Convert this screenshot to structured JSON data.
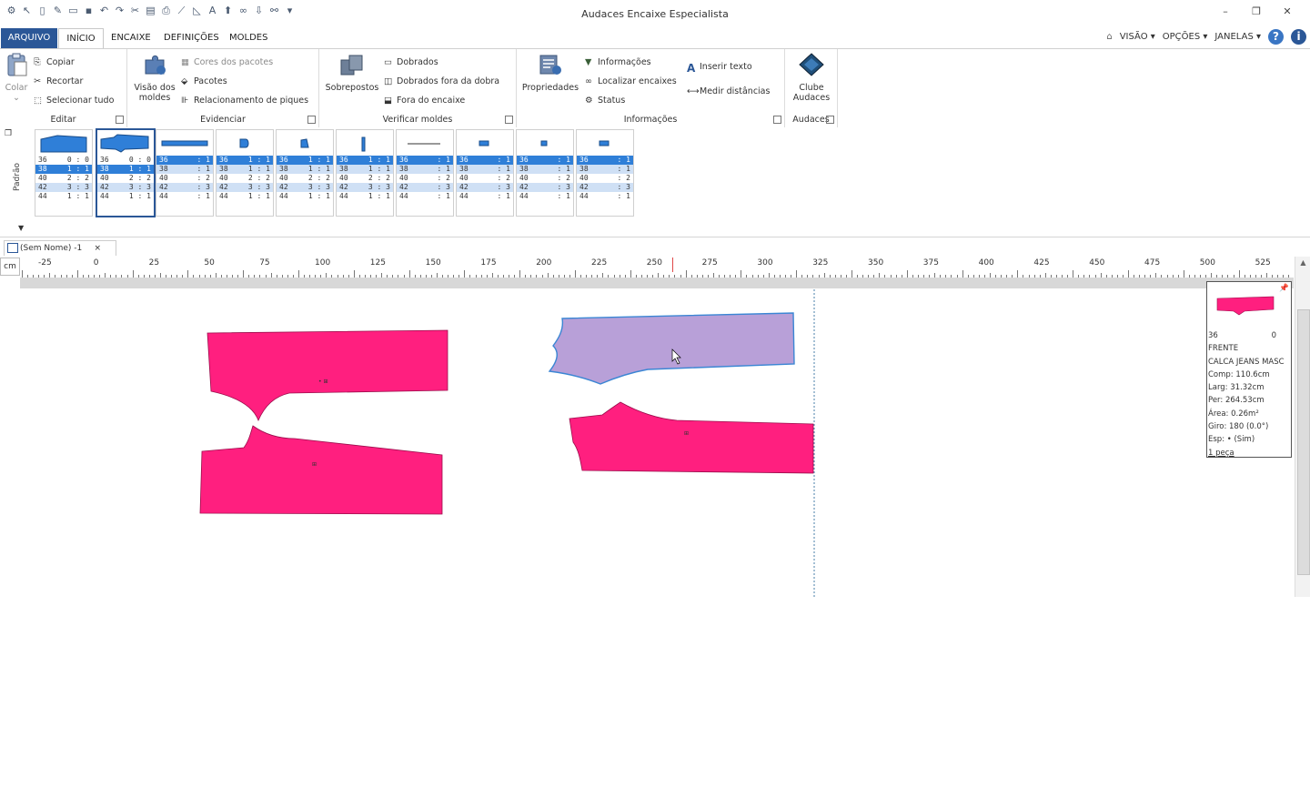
{
  "window": {
    "title": "Audaces Encaixe Especialista",
    "controls": [
      "–",
      "❐",
      "✕"
    ]
  },
  "tabs": {
    "arquivo": "ARQUIVO",
    "inicio": "INÍCIO",
    "encaixe": "ENCAIXE",
    "definicoes": "DEFINIÇÕES",
    "moldes": "MOLDES"
  },
  "right_menu": {
    "visao": "VISÃO ▾",
    "opcoes": "OPÇÕES ▾",
    "janelas": "JANELAS ▾",
    "help": "?",
    "info": "i"
  },
  "ribbon": {
    "editar": {
      "label": "Editar",
      "colar": "Colar",
      "copiar": "Copiar",
      "recortar": "Recortar",
      "selecionar_tudo": "Selecionar tudo"
    },
    "evidenciar": {
      "label": "Evidenciar",
      "visao_moldes_1": "Visão dos",
      "visao_moldes_2": "moldes",
      "cores_pacotes": "Cores dos pacotes",
      "pacotes": "Pacotes",
      "relacionamento": "Relacionamento de piques"
    },
    "verificar": {
      "label": "Verificar moldes",
      "sobrepostos": "Sobrepostos",
      "dobrados": "Dobrados",
      "dobrados_fora": "Dobrados fora da dobra",
      "fora_encaixe": "Fora do encaixe"
    },
    "informacoes": {
      "label": "Informações",
      "propriedades": "Propriedades",
      "informacoes": "Informações",
      "localizar": "Localizar encaixes",
      "status": "Status",
      "inserir_texto": "Inserir texto",
      "medir": "Medir distâncias"
    },
    "audaces": {
      "label": "Audaces",
      "clube_1": "Clube",
      "clube_2": "Audaces"
    }
  },
  "strip": {
    "padrao": "Padrão",
    "cards": [
      {
        "rows": [
          [
            "36",
            "0 : 0"
          ],
          [
            "38",
            "1 : 1"
          ],
          [
            "40",
            "2 : 2"
          ],
          [
            "42",
            "3 : 3"
          ],
          [
            "44",
            "1 : 1"
          ]
        ]
      },
      {
        "rows": [
          [
            "36",
            "0 : 0"
          ],
          [
            "38",
            "1 : 1"
          ],
          [
            "40",
            "2 : 2"
          ],
          [
            "42",
            "3 : 3"
          ],
          [
            "44",
            "1 : 1"
          ]
        ]
      },
      {
        "rows": [
          [
            "36",
            ": 1"
          ],
          [
            "38",
            ": 1"
          ],
          [
            "40",
            ": 2"
          ],
          [
            "42",
            ": 3"
          ],
          [
            "44",
            ": 1"
          ]
        ]
      },
      {
        "rows": [
          [
            "36",
            "1 : 1"
          ],
          [
            "38",
            "1 : 1"
          ],
          [
            "40",
            "2 : 2"
          ],
          [
            "42",
            "3 : 3"
          ],
          [
            "44",
            "1 : 1"
          ]
        ]
      },
      {
        "rows": [
          [
            "36",
            "1 : 1"
          ],
          [
            "38",
            "1 : 1"
          ],
          [
            "40",
            "2 : 2"
          ],
          [
            "42",
            "3 : 3"
          ],
          [
            "44",
            "1 : 1"
          ]
        ]
      },
      {
        "rows": [
          [
            "36",
            "1 : 1"
          ],
          [
            "38",
            "1 : 1"
          ],
          [
            "40",
            "2 : 2"
          ],
          [
            "42",
            "3 : 3"
          ],
          [
            "44",
            "1 : 1"
          ]
        ]
      },
      {
        "rows": [
          [
            "36",
            ": 1"
          ],
          [
            "38",
            ": 1"
          ],
          [
            "40",
            ": 2"
          ],
          [
            "42",
            ": 3"
          ],
          [
            "44",
            ": 1"
          ]
        ]
      },
      {
        "rows": [
          [
            "36",
            ": 1"
          ],
          [
            "38",
            ": 1"
          ],
          [
            "40",
            ": 2"
          ],
          [
            "42",
            ": 3"
          ],
          [
            "44",
            ": 1"
          ]
        ]
      },
      {
        "rows": [
          [
            "36",
            ": 1"
          ],
          [
            "38",
            ": 1"
          ],
          [
            "40",
            ": 2"
          ],
          [
            "42",
            ": 3"
          ],
          [
            "44",
            ": 1"
          ]
        ]
      },
      {
        "rows": [
          [
            "36",
            ": 1"
          ],
          [
            "38",
            ": 1"
          ],
          [
            "40",
            ": 2"
          ],
          [
            "42",
            ": 3"
          ],
          [
            "44",
            ": 1"
          ]
        ]
      }
    ]
  },
  "document": {
    "tab_name": "(Sem Nome) -1",
    "close": "×",
    "unit": "cm",
    "ruler_labels": [
      "-25",
      "0",
      "25",
      "50",
      "75",
      "100",
      "125",
      "150",
      "175",
      "200",
      "225",
      "250",
      "275",
      "300",
      "325",
      "350",
      "375",
      "400",
      "425",
      "450",
      "475",
      "500",
      "525"
    ]
  },
  "piece_info": {
    "size": "36",
    "rotation_count": "0",
    "name": "FRENTE",
    "model": "CALCA JEANS MASC",
    "comp": "Comp: 110.6cm",
    "larg": "Larg: 31.32cm",
    "per": "Per: 264.53cm",
    "area": "Área: 0.26m²",
    "giro": "Giro: 180  (0.0°)",
    "esp": "Esp: •  (Sim)",
    "pecas": "1 peça"
  },
  "colors": {
    "accent": "#2b5797",
    "piece_pink": "#ff1f7f",
    "piece_selected": "#b8a0d8",
    "thumb_blue": "#2f7fd8"
  }
}
